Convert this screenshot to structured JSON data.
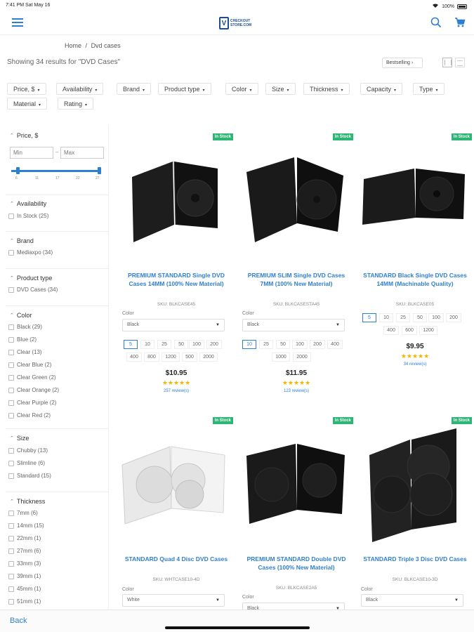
{
  "status": {
    "time": "7:41 PM  Sat May 16",
    "battery": "100%"
  },
  "header": {
    "logo_mark": "V",
    "logo_line1": "CHECKOUT",
    "logo_line2": "STORE.COM",
    "menu_icon": "hamburger-icon",
    "search_icon": "search-icon",
    "cart_icon": "cart-icon"
  },
  "breadcrumb": {
    "home": "Home",
    "sep": "/",
    "current": "Dvd cases"
  },
  "results_text": "Showing 34 results for \"DVD Cases\"",
  "sort": {
    "label": "Bestselling",
    "arrow": "›"
  },
  "filters": [
    "Price, $",
    "Availability",
    "Brand",
    "Product type",
    "Color",
    "Size",
    "Thickness",
    "Capacity",
    "Type",
    "Material",
    "Rating"
  ],
  "sidebar": {
    "price": {
      "title": "Price, $",
      "min_placeholder": "Min",
      "max_placeholder": "Max",
      "dash": "–",
      "ticks": [
        "6",
        "11",
        "17",
        "22",
        "27"
      ]
    },
    "availability": {
      "title": "Availability",
      "options": [
        "In Stock (25)"
      ]
    },
    "brand": {
      "title": "Brand",
      "options": [
        "Mediaxpo (34)"
      ]
    },
    "product_type": {
      "title": "Product type",
      "options": [
        "DVD Cases (34)"
      ]
    },
    "color": {
      "title": "Color",
      "options": [
        "Black (29)",
        "Blue (2)",
        "Clear (13)",
        "Clear Blue (2)",
        "Clear Green (2)",
        "Clear Orange (2)",
        "Clear Purple (2)",
        "Clear Red (2)"
      ]
    },
    "size": {
      "title": "Size",
      "options": [
        "Chubby (13)",
        "Slimline (6)",
        "Standard (15)"
      ]
    },
    "thickness": {
      "title": "Thickness",
      "options": [
        "7mm (6)",
        "14mm (15)",
        "22mm (1)",
        "27mm (6)",
        "33mm (3)",
        "39mm (1)",
        "45mm (1)",
        "51mm (1)"
      ]
    }
  },
  "products": [
    {
      "badge": "In Stock",
      "title": "PREMIUM STANDARD Single DVD Cases 14MM (100% New Material)",
      "sku": "SKU: BLKCASE45",
      "color_label": "Color",
      "color": "Black",
      "qtys": [
        "5",
        "10",
        "25",
        "50",
        "100",
        "200",
        "400",
        "800",
        "1200",
        "500",
        "2000"
      ],
      "price": "$10.95",
      "stars": "★★★★★",
      "reviews": "257 review(s)"
    },
    {
      "badge": "In Stock",
      "title": "PREMIUM SLIM Single DVD Cases 7MM (100% New Material)",
      "sku": "SKU: BLKCASESTA45",
      "color_label": "Color",
      "color": "Black",
      "qtys": [
        "10",
        "25",
        "50",
        "100",
        "200",
        "400",
        "1000",
        "2000"
      ],
      "price": "$11.95",
      "stars": "★★★★★",
      "reviews": "123 review(s)"
    },
    {
      "badge": "In Stock",
      "title": "STANDARD Black Single DVD Cases 14MM (Machinable Quality)",
      "sku": "SKU: BLKCASE05",
      "qtys": [
        "5",
        "10",
        "25",
        "50",
        "100",
        "200",
        "400",
        "600",
        "1200"
      ],
      "price": "$9.95",
      "stars": "★★★★★",
      "reviews": "34 review(s)"
    },
    {
      "badge": "In Stock",
      "title": "STANDARD Quad 4 Disc DVD Cases",
      "sku": "SKU: WHTCASE10-4D",
      "color_label": "Color",
      "color": "White"
    },
    {
      "badge": "In Stock",
      "title": "PREMIUM STANDARD Double DVD Cases (100% New Material)",
      "sku": "SKU: BLKCASE2A5",
      "color_label": "Color",
      "color": "Black"
    },
    {
      "badge": "In Stock",
      "title": "STANDARD Triple 3 Disc DVD Cases",
      "sku": "SKU: BLKCASE10-3D",
      "color_label": "Color",
      "color": "Black"
    }
  ],
  "footer": {
    "back": "Back"
  },
  "colors": {
    "accent": "#2d7fd4",
    "badge": "#2bb673",
    "star": "#f6b400"
  }
}
